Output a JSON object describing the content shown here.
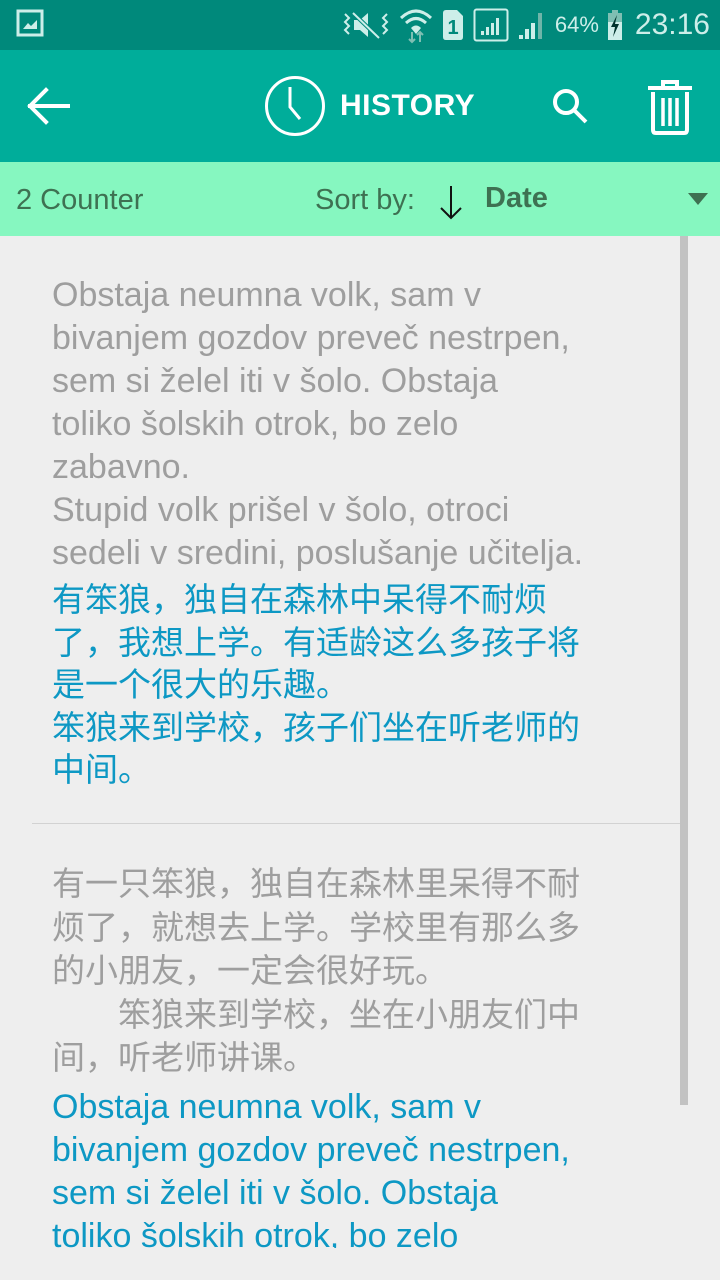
{
  "status_bar": {
    "left_icon": "gallery-notification-icon",
    "icons": [
      "vibrate-mute-icon",
      "wifi-icon",
      "sim-1-icon",
      "signal-icon",
      "signal-2-icon",
      "battery-charging-icon"
    ],
    "sim_label": "1",
    "battery": "64%",
    "time": "23:16"
  },
  "app_bar": {
    "back_icon": "arrow-left-icon",
    "title_icon": "clock-icon",
    "title": "HISTORY",
    "search_icon": "search-icon",
    "delete_icon": "trash-icon"
  },
  "sort_bar": {
    "counter": "2 Counter",
    "sort_label": "Sort by:",
    "sort_direction": "descending",
    "sort_value": "Date"
  },
  "entries": [
    {
      "source": "Obstaja neumna volk, sam v\nbivanjem gozdov preveč nestrpen,\nsem si želel iti v šolo. Obstaja\ntoliko šolskih otrok, bo zelo\nzabavno.\nStupid volk prišel v šolo, otroci\nsedeli v sredini, poslušanje učitelja.",
      "translation": "有笨狼，独自在森林中呆得不耐烦\n了，我想上学。有适龄这么多孩子将\n是一个很大的乐趣。\n笨狼来到学校，孩子们坐在听老师的\n中间。"
    },
    {
      "source": "有一只笨狼，独自在森林里呆得不耐\n烦了，就想去上学。学校里有那么多\n的小朋友，一定会很好玩。\n　　笨狼来到学校，坐在小朋友们中\n间，听老师讲课。",
      "translation": "Obstaja neumna volk, sam v\nbivanjem gozdov preveč nestrpen,\nsem si želel iti v šolo. Obstaja\ntoliko šolskih otrok, bo zelo"
    }
  ],
  "colors": {
    "status_bar": "#00897b",
    "app_bar": "#00ad9a",
    "sort_bar": "#86f7c0",
    "sort_text": "#3e7152",
    "source_text": "#9e9e9e",
    "translation_text": "#0d98c4",
    "background": "#eeeeee"
  }
}
